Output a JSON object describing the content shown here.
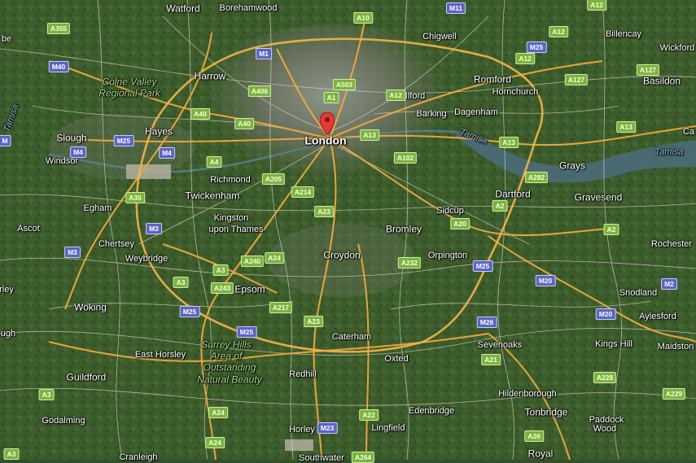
{
  "map": {
    "pin_place": "London",
    "colors": {
      "land_dark": "#2f4a24",
      "land_mid": "#4b6a34",
      "urban": "#8a8f86",
      "motorway": "#f2a93b",
      "minor_road": "#d9d3c4",
      "water": "#4a6b7a",
      "pin": "#e53935"
    },
    "places": [
      {
        "name": "Watford",
        "size": "mid"
      },
      {
        "name": "Borehamwood"
      },
      {
        "name": "Chigwell"
      },
      {
        "name": "Billericay"
      },
      {
        "name": "Wickford"
      },
      {
        "name": "Harrow",
        "size": "mid"
      },
      {
        "name": "Romford",
        "size": "mid"
      },
      {
        "name": "Basildon",
        "size": "mid"
      },
      {
        "name": "Hornchurch"
      },
      {
        "name": "Ilford"
      },
      {
        "name": "Barking"
      },
      {
        "name": "Dagenham"
      },
      {
        "name": "Slough",
        "size": "mid"
      },
      {
        "name": "Hayes",
        "size": "mid"
      },
      {
        "name": "London",
        "size": "big"
      },
      {
        "name": "Windsor"
      },
      {
        "name": "Richmond"
      },
      {
        "name": "Grays",
        "size": "mid"
      },
      {
        "name": "Twickenham",
        "size": "mid"
      },
      {
        "name": "Dartford",
        "size": "mid"
      },
      {
        "name": "Gravesend",
        "size": "mid"
      },
      {
        "name": "Egham"
      },
      {
        "name": "Sidcup"
      },
      {
        "name": "Kingston"
      },
      {
        "name": "upon Thames"
      },
      {
        "name": "Bromley",
        "size": "mid"
      },
      {
        "name": "Ascot"
      },
      {
        "name": "Chertsey"
      },
      {
        "name": "Rochester"
      },
      {
        "name": "Weybridge"
      },
      {
        "name": "Croydon",
        "size": "mid"
      },
      {
        "name": "Orpington"
      },
      {
        "name": "Epsom",
        "size": "mid"
      },
      {
        "name": "Snodland"
      },
      {
        "name": "Woking",
        "size": "mid"
      },
      {
        "name": "Aylesford"
      },
      {
        "name": "Caterham"
      },
      {
        "name": "Sevenoaks"
      },
      {
        "name": "Kings Hill"
      },
      {
        "name": "Maidston"
      },
      {
        "name": "East Horsley"
      },
      {
        "name": "Oxted"
      },
      {
        "name": "Guildford",
        "size": "mid"
      },
      {
        "name": "Redhill"
      },
      {
        "name": "Hildenborough"
      },
      {
        "name": "Tonbridge",
        "size": "mid"
      },
      {
        "name": "Paddock"
      },
      {
        "name": "Wood"
      },
      {
        "name": "Godalming"
      },
      {
        "name": "Edenbridge"
      },
      {
        "name": "Horley"
      },
      {
        "name": "Lingfield"
      },
      {
        "name": "Royal",
        "size": "mid"
      },
      {
        "name": "Cranleigh"
      },
      {
        "name": "Southwater"
      },
      {
        "name": "ugh"
      },
      {
        "name": "rley"
      },
      {
        "name": "be"
      },
      {
        "name": "Ca"
      }
    ],
    "areas": [
      {
        "name": "Colne Valley"
      },
      {
        "name": "Regional Park"
      },
      {
        "name": "Surrey Hills"
      },
      {
        "name": "Area of"
      },
      {
        "name": "Outstanding"
      },
      {
        "name": "Natural Beauty"
      }
    ],
    "water": [
      {
        "name": "Tamisa"
      },
      {
        "name": "Tamisa"
      },
      {
        "name": "Tamisa"
      }
    ],
    "road_shields": [
      {
        "ref": "A355",
        "type": "a"
      },
      {
        "ref": "M40",
        "type": "m"
      },
      {
        "ref": "M1",
        "type": "m"
      },
      {
        "ref": "A10",
        "type": "a"
      },
      {
        "ref": "M11",
        "type": "m"
      },
      {
        "ref": "A12",
        "type": "a"
      },
      {
        "ref": "A12",
        "type": "a"
      },
      {
        "ref": "M25",
        "type": "m"
      },
      {
        "ref": "A12",
        "type": "a"
      },
      {
        "ref": "A127",
        "type": "a"
      },
      {
        "ref": "A127",
        "type": "a"
      },
      {
        "ref": "A406",
        "type": "a"
      },
      {
        "ref": "A503",
        "type": "a"
      },
      {
        "ref": "A1",
        "type": "a"
      },
      {
        "ref": "A12",
        "type": "a"
      },
      {
        "ref": "A40",
        "type": "a"
      },
      {
        "ref": "A40",
        "type": "a"
      },
      {
        "ref": "A13",
        "type": "a"
      },
      {
        "ref": "A13",
        "type": "a"
      },
      {
        "ref": "A13",
        "type": "a"
      },
      {
        "ref": "M",
        "type": "m"
      },
      {
        "ref": "M25",
        "type": "m"
      },
      {
        "ref": "M4",
        "type": "m"
      },
      {
        "ref": "M4",
        "type": "m"
      },
      {
        "ref": "A4",
        "type": "a"
      },
      {
        "ref": "A102",
        "type": "a"
      },
      {
        "ref": "A282",
        "type": "a"
      },
      {
        "ref": "A205",
        "type": "a"
      },
      {
        "ref": "A30",
        "type": "a"
      },
      {
        "ref": "A214",
        "type": "a"
      },
      {
        "ref": "A2",
        "type": "a"
      },
      {
        "ref": "A23",
        "type": "a"
      },
      {
        "ref": "A20",
        "type": "a"
      },
      {
        "ref": "A2",
        "type": "a"
      },
      {
        "ref": "M3",
        "type": "m"
      },
      {
        "ref": "M3",
        "type": "m"
      },
      {
        "ref": "A240",
        "type": "a"
      },
      {
        "ref": "A24",
        "type": "a"
      },
      {
        "ref": "A232",
        "type": "a"
      },
      {
        "ref": "M25",
        "type": "m"
      },
      {
        "ref": "A3",
        "type": "a"
      },
      {
        "ref": "M20",
        "type": "m"
      },
      {
        "ref": "M2",
        "type": "m"
      },
      {
        "ref": "A3",
        "type": "a"
      },
      {
        "ref": "A243",
        "type": "a"
      },
      {
        "ref": "A217",
        "type": "a"
      },
      {
        "ref": "M25",
        "type": "m"
      },
      {
        "ref": "M20",
        "type": "m"
      },
      {
        "ref": "M26",
        "type": "m"
      },
      {
        "ref": "A23",
        "type": "a"
      },
      {
        "ref": "M25",
        "type": "m"
      },
      {
        "ref": "A21",
        "type": "a"
      },
      {
        "ref": "A228",
        "type": "a"
      },
      {
        "ref": "A229",
        "type": "a"
      },
      {
        "ref": "A3",
        "type": "a"
      },
      {
        "ref": "A24",
        "type": "a"
      },
      {
        "ref": "A22",
        "type": "a"
      },
      {
        "ref": "M23",
        "type": "m"
      },
      {
        "ref": "A26",
        "type": "a"
      },
      {
        "ref": "A24",
        "type": "a"
      },
      {
        "ref": "A3",
        "type": "a"
      },
      {
        "ref": "A264",
        "type": "a"
      }
    ]
  }
}
